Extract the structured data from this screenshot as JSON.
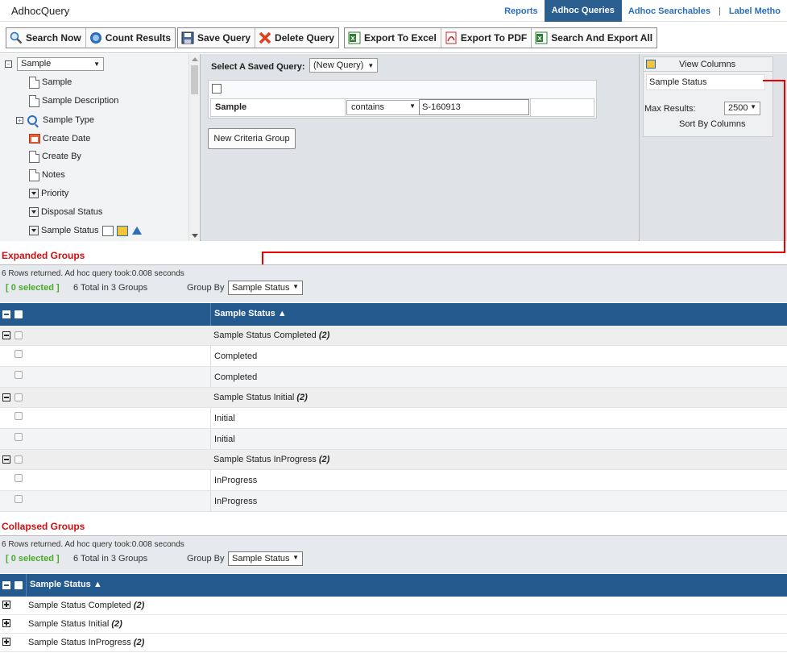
{
  "app": {
    "title": "AdhocQuery"
  },
  "topnav": {
    "items": [
      {
        "label": "Reports"
      },
      {
        "label": "Adhoc Queries"
      },
      {
        "label": "Adhoc Searchables"
      },
      {
        "label": "Label Metho"
      }
    ],
    "separator": "|"
  },
  "toolbar": {
    "search_now": "Search Now",
    "count_results": "Count Results",
    "save_query": "Save Query",
    "delete_query": "Delete Query",
    "export_excel": "Export To Excel",
    "export_pdf": "Export To PDF",
    "search_export_all": "Search And Export All"
  },
  "fields": {
    "entity_select": "Sample",
    "items": [
      {
        "label": "Sample",
        "icon": "document-icon"
      },
      {
        "label": "Sample Description",
        "icon": "document-icon"
      },
      {
        "label": "Sample Type",
        "icon": "magnifier-icon"
      },
      {
        "label": "Create Date",
        "icon": "calendar-icon"
      },
      {
        "label": "Create By",
        "icon": "document-icon"
      },
      {
        "label": "Notes",
        "icon": "document-icon"
      },
      {
        "label": "Priority",
        "icon": "dropdown-icon"
      },
      {
        "label": "Disposal Status",
        "icon": "dropdown-icon"
      },
      {
        "label": "Sample Status",
        "icon": "dropdown-icon"
      }
    ]
  },
  "query": {
    "saved_label": "Select A Saved Query:",
    "saved_value": "(New Query)",
    "criteria": {
      "field": "Sample",
      "operator": "contains",
      "value": "S-160913"
    },
    "new_group_button": "New Criteria Group"
  },
  "view_columns": {
    "title": "View Columns",
    "items": [
      "Sample Status"
    ],
    "max_results_label": "Max Results:",
    "max_results_value": "2500",
    "sort_by_label": "Sort By Columns"
  },
  "expanded": {
    "section_title": "Expanded Groups",
    "info": "6 Rows returned. Ad hoc query took:0.008 seconds",
    "selected": "[ 0 selected ]",
    "total": "6 Total in 3 Groups",
    "group_by_label": "Group By",
    "group_by_value": "Sample Status",
    "column_header": "Sample Status ▲",
    "groups": [
      {
        "label": "Sample Status Completed",
        "count": "(2)",
        "rows": [
          "Completed",
          "Completed"
        ]
      },
      {
        "label": "Sample Status Initial",
        "count": "(2)",
        "rows": [
          "Initial",
          "Initial"
        ]
      },
      {
        "label": "Sample Status InProgress",
        "count": "(2)",
        "rows": [
          "InProgress",
          "InProgress"
        ]
      }
    ]
  },
  "collapsed": {
    "section_title": "Collapsed Groups",
    "info": "6 Rows returned. Ad hoc query took:0.008 seconds",
    "selected": "[ 0 selected ]",
    "total": "6 Total in 3 Groups",
    "group_by_label": "Group By",
    "group_by_value": "Sample Status",
    "column_header": "Sample Status ▲",
    "groups": [
      {
        "label": "Sample Status Completed",
        "count": "(2)"
      },
      {
        "label": "Sample Status Initial",
        "count": "(2)"
      },
      {
        "label": "Sample Status InProgress",
        "count": "(2)"
      }
    ]
  },
  "colors": {
    "header_blue": "#245a8e",
    "active_nav": "#2a5f8f",
    "annotation_red": "#e00000",
    "selected_green": "#4caa2a"
  }
}
